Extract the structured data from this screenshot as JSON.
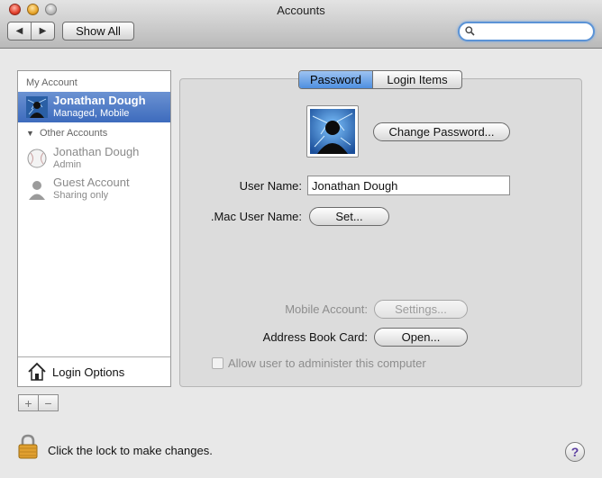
{
  "window": {
    "title": "Accounts"
  },
  "toolbar": {
    "back_glyph": "◀",
    "forward_glyph": "▶",
    "show_all_label": "Show All",
    "search_value": "",
    "search_placeholder": ""
  },
  "sidebar": {
    "my_account_header": "My Account",
    "my_account": {
      "name": "Jonathan Dough",
      "sub": "Managed, Mobile"
    },
    "other_accounts_header": "Other Accounts",
    "other_accounts": [
      {
        "name": "Jonathan Dough",
        "sub": "Admin"
      },
      {
        "name": "Guest Account",
        "sub": "Sharing only"
      }
    ],
    "login_options_label": "Login Options",
    "add_label": "+",
    "remove_label": "−"
  },
  "tabs": [
    {
      "label": "Password",
      "selected": true
    },
    {
      "label": "Login Items",
      "selected": false
    }
  ],
  "form": {
    "change_password_label": "Change Password...",
    "user_name_label": "User Name:",
    "user_name_value": "Jonathan Dough",
    "mac_user_name_label": ".Mac User Name:",
    "set_label": "Set...",
    "mobile_account_label": "Mobile Account:",
    "settings_label": "Settings...",
    "address_book_label": "Address Book Card:",
    "open_label": "Open...",
    "admin_checkbox_label": "Allow user to administer this computer",
    "admin_checkbox_checked": false
  },
  "footer": {
    "lock_text": "Click the lock to make changes.",
    "help_label": "?"
  },
  "colors": {
    "selection": "#3d6bbd",
    "tab_selected": "#4e8fe0",
    "search_focus": "#5b93d6"
  }
}
